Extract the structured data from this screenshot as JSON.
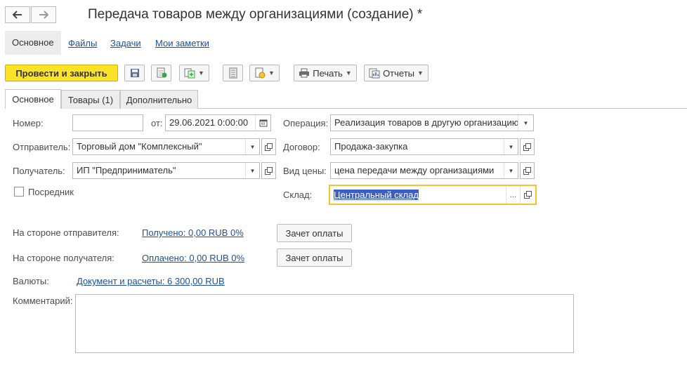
{
  "window": {
    "title": "Передача товаров между организациями (создание) *"
  },
  "nav": {
    "back_icon": "arrow-left-icon",
    "forward_icon": "arrow-right-icon"
  },
  "sections": [
    {
      "label": "Основное",
      "active": true
    },
    {
      "label": "Файлы",
      "active": false
    },
    {
      "label": "Задачи",
      "active": false
    },
    {
      "label": "Мои заметки",
      "active": false
    }
  ],
  "toolbar": {
    "post_close_label": "Провести и закрыть",
    "save_icon": "save-icon",
    "post_icon": "post-icon",
    "create_based_icon": "create-based-icon",
    "journal_icon": "journal-icon",
    "attach_icon": "attach-icon",
    "print_label": "Печать",
    "reports_label": "Отчеты"
  },
  "tabs": [
    {
      "label": "Основное",
      "active": true
    },
    {
      "label": "Товары (1)",
      "active": false
    },
    {
      "label": "Дополнительно",
      "active": false
    }
  ],
  "form": {
    "number_label": "Номер:",
    "number_value": "",
    "date_label": "от:",
    "date_value": "29.06.2021  0:00:00",
    "operation_label": "Операция:",
    "operation_value": "Реализация товаров в другую организацию",
    "sender_label": "Отправитель:",
    "sender_value": "Торговый дом \"Комплексный\"",
    "contract_label": "Договор:",
    "contract_value": "Продажа-закупка",
    "receiver_label": "Получатель:",
    "receiver_value": "ИП \"Предприниматель\"",
    "price_type_label": "Вид цены:",
    "price_type_value": "цена передачи между организациями",
    "intermediary_label": "Посредник",
    "intermediary_checked": false,
    "warehouse_label": "Склад:",
    "warehouse_value": "Центральный склад",
    "sender_side_label": "На стороне отправителя:",
    "sender_side_link": "Получено: 0,00 RUB  0%",
    "offset_label_1": "Зачет оплаты",
    "receiver_side_label": "На стороне получателя:",
    "receiver_side_link": "Оплачено: 0,00 RUB  0%",
    "offset_label_2": "Зачет оплаты",
    "currencies_label": "Валюты:",
    "currencies_link": "Документ и расчеты: 6 300,00 RUB",
    "comment_label": "Комментарий:",
    "comment_value": "",
    "ellipsis": "..."
  },
  "colors": {
    "primary_button": "#fce229",
    "link": "#1d4f9c",
    "focus": "#f2c52d",
    "selection": "#3e5fc2"
  }
}
